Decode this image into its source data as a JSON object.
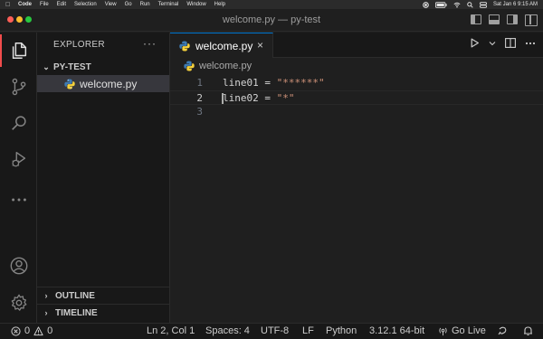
{
  "menubar": {
    "app": "Code",
    "items": [
      "File",
      "Edit",
      "Selection",
      "View",
      "Go",
      "Run",
      "Terminal",
      "Window",
      "Help"
    ],
    "datetime": "Sat Jan 6  9:15 AM"
  },
  "window": {
    "title": "welcome.py — py-test"
  },
  "sidebar": {
    "title": "EXPLORER",
    "more": "···",
    "folder": "PY-TEST",
    "files": [
      {
        "name": "welcome.py",
        "icon": "python-icon"
      }
    ],
    "sections": [
      "OUTLINE",
      "TIMELINE"
    ]
  },
  "editor": {
    "tab": {
      "label": "welcome.py",
      "close": "×"
    },
    "breadcrumb": "welcome.py",
    "lines": [
      {
        "num": "1",
        "prefix": "line01 = ",
        "string": "\"******\""
      },
      {
        "num": "2",
        "prefix": "line02 = ",
        "string": "\"*\""
      },
      {
        "num": "3",
        "prefix": "",
        "string": ""
      }
    ]
  },
  "statusbar": {
    "errors": "0",
    "warnings": "0",
    "position": "Ln 2, Col 1",
    "spaces": "Spaces: 4",
    "encoding": "UTF-8",
    "eol": "LF",
    "language": "Python",
    "interpreter": "3.12.1 64-bit",
    "golive": "Go Live"
  },
  "colors": {
    "accent": "#0078d4",
    "active_indicator": "#f14c4c",
    "string": "#ce9178",
    "background": "#1f1f1f"
  }
}
